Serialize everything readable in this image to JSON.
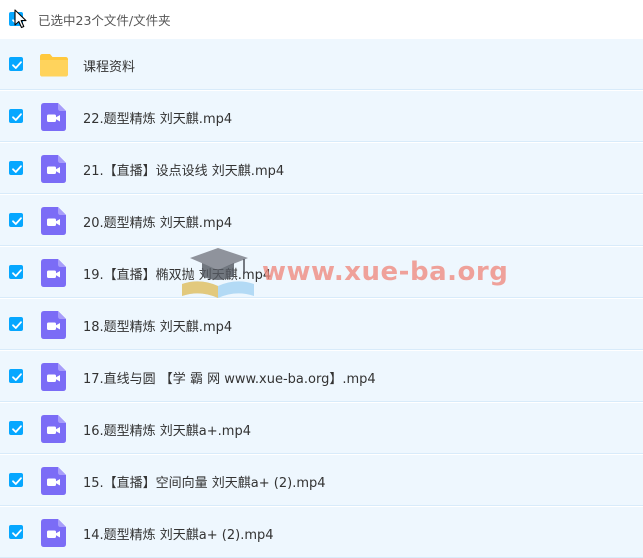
{
  "header": {
    "selection_text": "已选中23个文件/文件夹"
  },
  "files": [
    {
      "name": "课程资料",
      "type": "folder"
    },
    {
      "name": "22.题型精炼 刘天麒.mp4",
      "type": "video"
    },
    {
      "name": "21.【直播】设点设线 刘天麒.mp4",
      "type": "video"
    },
    {
      "name": "20.题型精炼 刘天麒.mp4",
      "type": "video"
    },
    {
      "name": "19.【直播】椭双抛 刘天麒.mp4",
      "type": "video"
    },
    {
      "name": "18.题型精炼 刘天麒.mp4",
      "type": "video"
    },
    {
      "name": "17.直线与圆 【学 霸 网 www.xue-ba.org】.mp4",
      "type": "video"
    },
    {
      "name": "16.题型精炼 刘天麒a+.mp4",
      "type": "video"
    },
    {
      "name": "15.【直播】空间向量 刘天麒a+ (2).mp4",
      "type": "video"
    },
    {
      "name": "14.题型精炼 刘天麒a+ (2).mp4",
      "type": "video"
    }
  ],
  "watermark": {
    "text": "www.xue-ba.org"
  },
  "colors": {
    "checkbox": "#06a7ff",
    "row_selected_bg": "#eef7fe",
    "folder": "#ffc83d",
    "video_icon": "#7b6cf6",
    "watermark": "#f08a7e"
  },
  "icons": {
    "checkbox": "checkmark-icon",
    "folder": "folder-icon",
    "video": "video-file-icon",
    "cursor": "mouse-cursor-icon",
    "watermark": "graduation-cap-book-icon"
  }
}
